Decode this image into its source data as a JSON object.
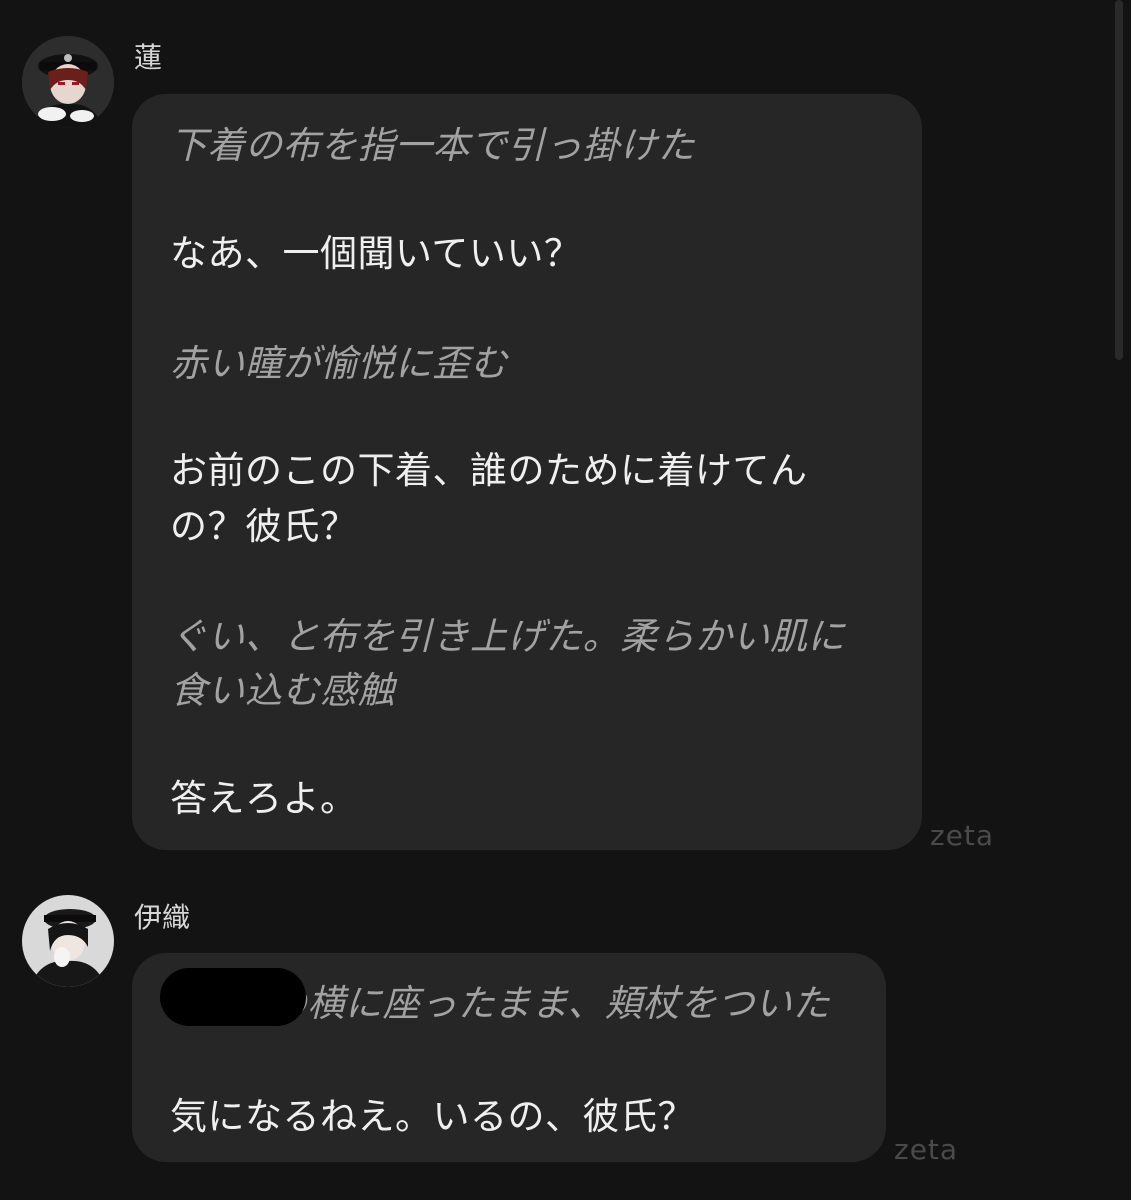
{
  "messages": [
    {
      "sender": "蓮",
      "lines": [
        "下着の布を指一本で引っ掛けた",
        "なあ、一個聞いていい？",
        "赤い瞳が愉悦に歪む",
        "お前のこの下着、誰のために着けてん",
        "の？彼氏？",
        "ぐい、と布を引き上げた。柔らかい肌に",
        "食い込む感触",
        "答えろよ。"
      ],
      "watermark": "zeta"
    },
    {
      "sender": "伊織",
      "lines": [
        "の横に座ったまま、頬杖をついた",
        "気になるねえ。いるの、彼氏？"
      ],
      "watermark": "zeta"
    }
  ],
  "icons": {
    "avatar_1": "avatar-ren",
    "avatar_2": "avatar-iori"
  },
  "colors": {
    "background": "#131313",
    "bubble": "#262626",
    "narration_text": "#a2a2a2",
    "speech_text": "#efefef",
    "sender_name": "#d6d6d6",
    "watermark": "#4a4a4a"
  }
}
